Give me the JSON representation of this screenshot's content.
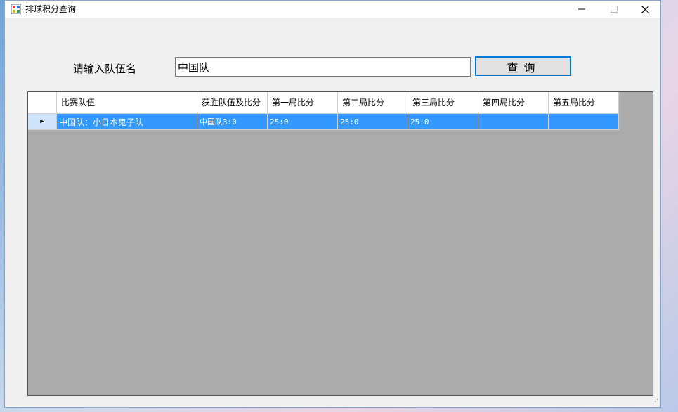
{
  "window": {
    "title": "排球积分查询",
    "controls": {
      "minimize": "—",
      "maximize": "☐",
      "close": "✕"
    }
  },
  "form": {
    "team_label": "请输入队伍名",
    "team_input_value": "中国队",
    "query_button_label": "查询"
  },
  "grid": {
    "columns": [
      "比赛队伍",
      "获胜队伍及比分",
      "第一局比分",
      "第二局比分",
      "第三局比分",
      "第四局比分",
      "第五局比分"
    ],
    "rows": [
      {
        "selected": true,
        "indicator": "▶",
        "cells": [
          "中国队：小日本鬼子队",
          "中国队3:0",
          "25:0",
          "25:0",
          "25:0",
          "",
          ""
        ]
      }
    ]
  },
  "icons": {
    "app": "app-icon",
    "row_indicator": "row-pointer-icon"
  },
  "colors": {
    "selection": "#3399ff",
    "grid_background": "#ababab",
    "button_border": "#0078d7"
  }
}
